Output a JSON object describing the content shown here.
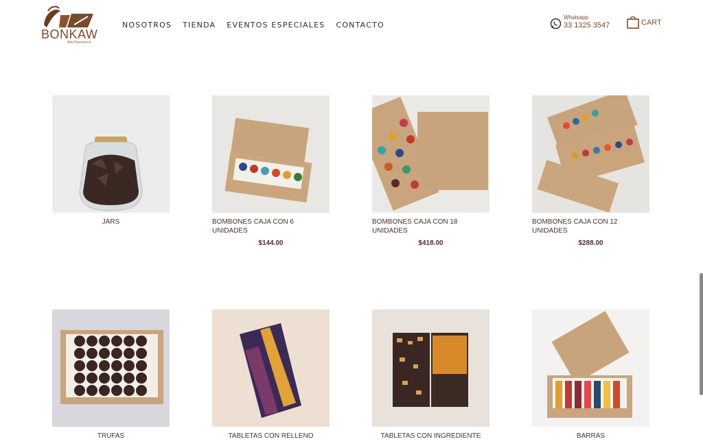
{
  "header": {
    "logo": {
      "brand": "BONKAW",
      "tagline": "Alta Repostería"
    },
    "nav": [
      {
        "label": "NOSOTROS"
      },
      {
        "label": "TIENDA"
      },
      {
        "label": "EVENTOS ESPECIALES"
      },
      {
        "label": "CONTACTO"
      }
    ],
    "whatsapp": {
      "label": "Whatsapp",
      "number": "33 1325 3547",
      "icon": "whatsapp-icon"
    },
    "cart": {
      "label": "CART",
      "icon": "shopping-bag-icon"
    }
  },
  "products": [
    {
      "name": "JARS",
      "price": ""
    },
    {
      "name": "BOMBONES CAJA CON 6 UNIDADES",
      "price": "$144.00"
    },
    {
      "name": "BOMBONES CAJA CON 18 UNIDADES",
      "price": "$418.00"
    },
    {
      "name": "BOMBONES CAJA CON 12 UNIDADES",
      "price": "$288.00"
    },
    {
      "name": "TRUFAS",
      "price": ""
    },
    {
      "name": "TABLETAS CON RELLENO",
      "price": ""
    },
    {
      "name": "TABLETAS CON INGREDIENTE",
      "price": ""
    },
    {
      "name": "BARRAS",
      "price": ""
    }
  ],
  "colors": {
    "brand": "#7a4a2e",
    "text": "#4a3128"
  }
}
